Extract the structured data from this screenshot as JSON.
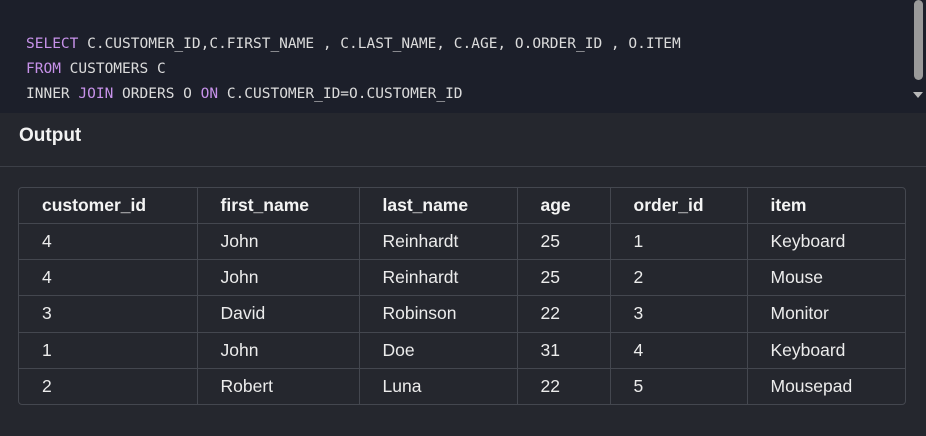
{
  "editor": {
    "lines": [
      [
        {
          "text": "SELECT",
          "kw": true
        },
        {
          "text": " C.CUSTOMER_ID,C.FIRST_NAME , C.LAST_NAME, C.AGE, O.ORDER_ID , O.ITEM",
          "kw": false
        }
      ],
      [
        {
          "text": "FROM",
          "kw": true
        },
        {
          "text": " CUSTOMERS C",
          "kw": false
        }
      ],
      [
        {
          "text": "INNER ",
          "kw": false
        },
        {
          "text": "JOIN",
          "kw": true
        },
        {
          "text": " ORDERS O ",
          "kw": false
        },
        {
          "text": "ON",
          "kw": true
        },
        {
          "text": " C.CUSTOMER_ID=O.CUSTOMER_ID",
          "kw": false
        }
      ]
    ],
    "colors": {
      "keyword": "#c792ea",
      "text": "#dcdcdc",
      "background": "#1c1f2a"
    }
  },
  "output": {
    "title": "Output",
    "columns": [
      "customer_id",
      "first_name",
      "last_name",
      "age",
      "order_id",
      "item"
    ],
    "rows": [
      [
        "4",
        "John",
        "Reinhardt",
        "25",
        "1",
        "Keyboard"
      ],
      [
        "4",
        "John",
        "Reinhardt",
        "25",
        "2",
        "Mouse"
      ],
      [
        "3",
        "David",
        "Robinson",
        "22",
        "3",
        "Monitor"
      ],
      [
        "1",
        "John",
        "Doe",
        "31",
        "4",
        "Keyboard"
      ],
      [
        "2",
        "Robert",
        "Luna",
        "22",
        "5",
        "Mousepad"
      ]
    ]
  }
}
